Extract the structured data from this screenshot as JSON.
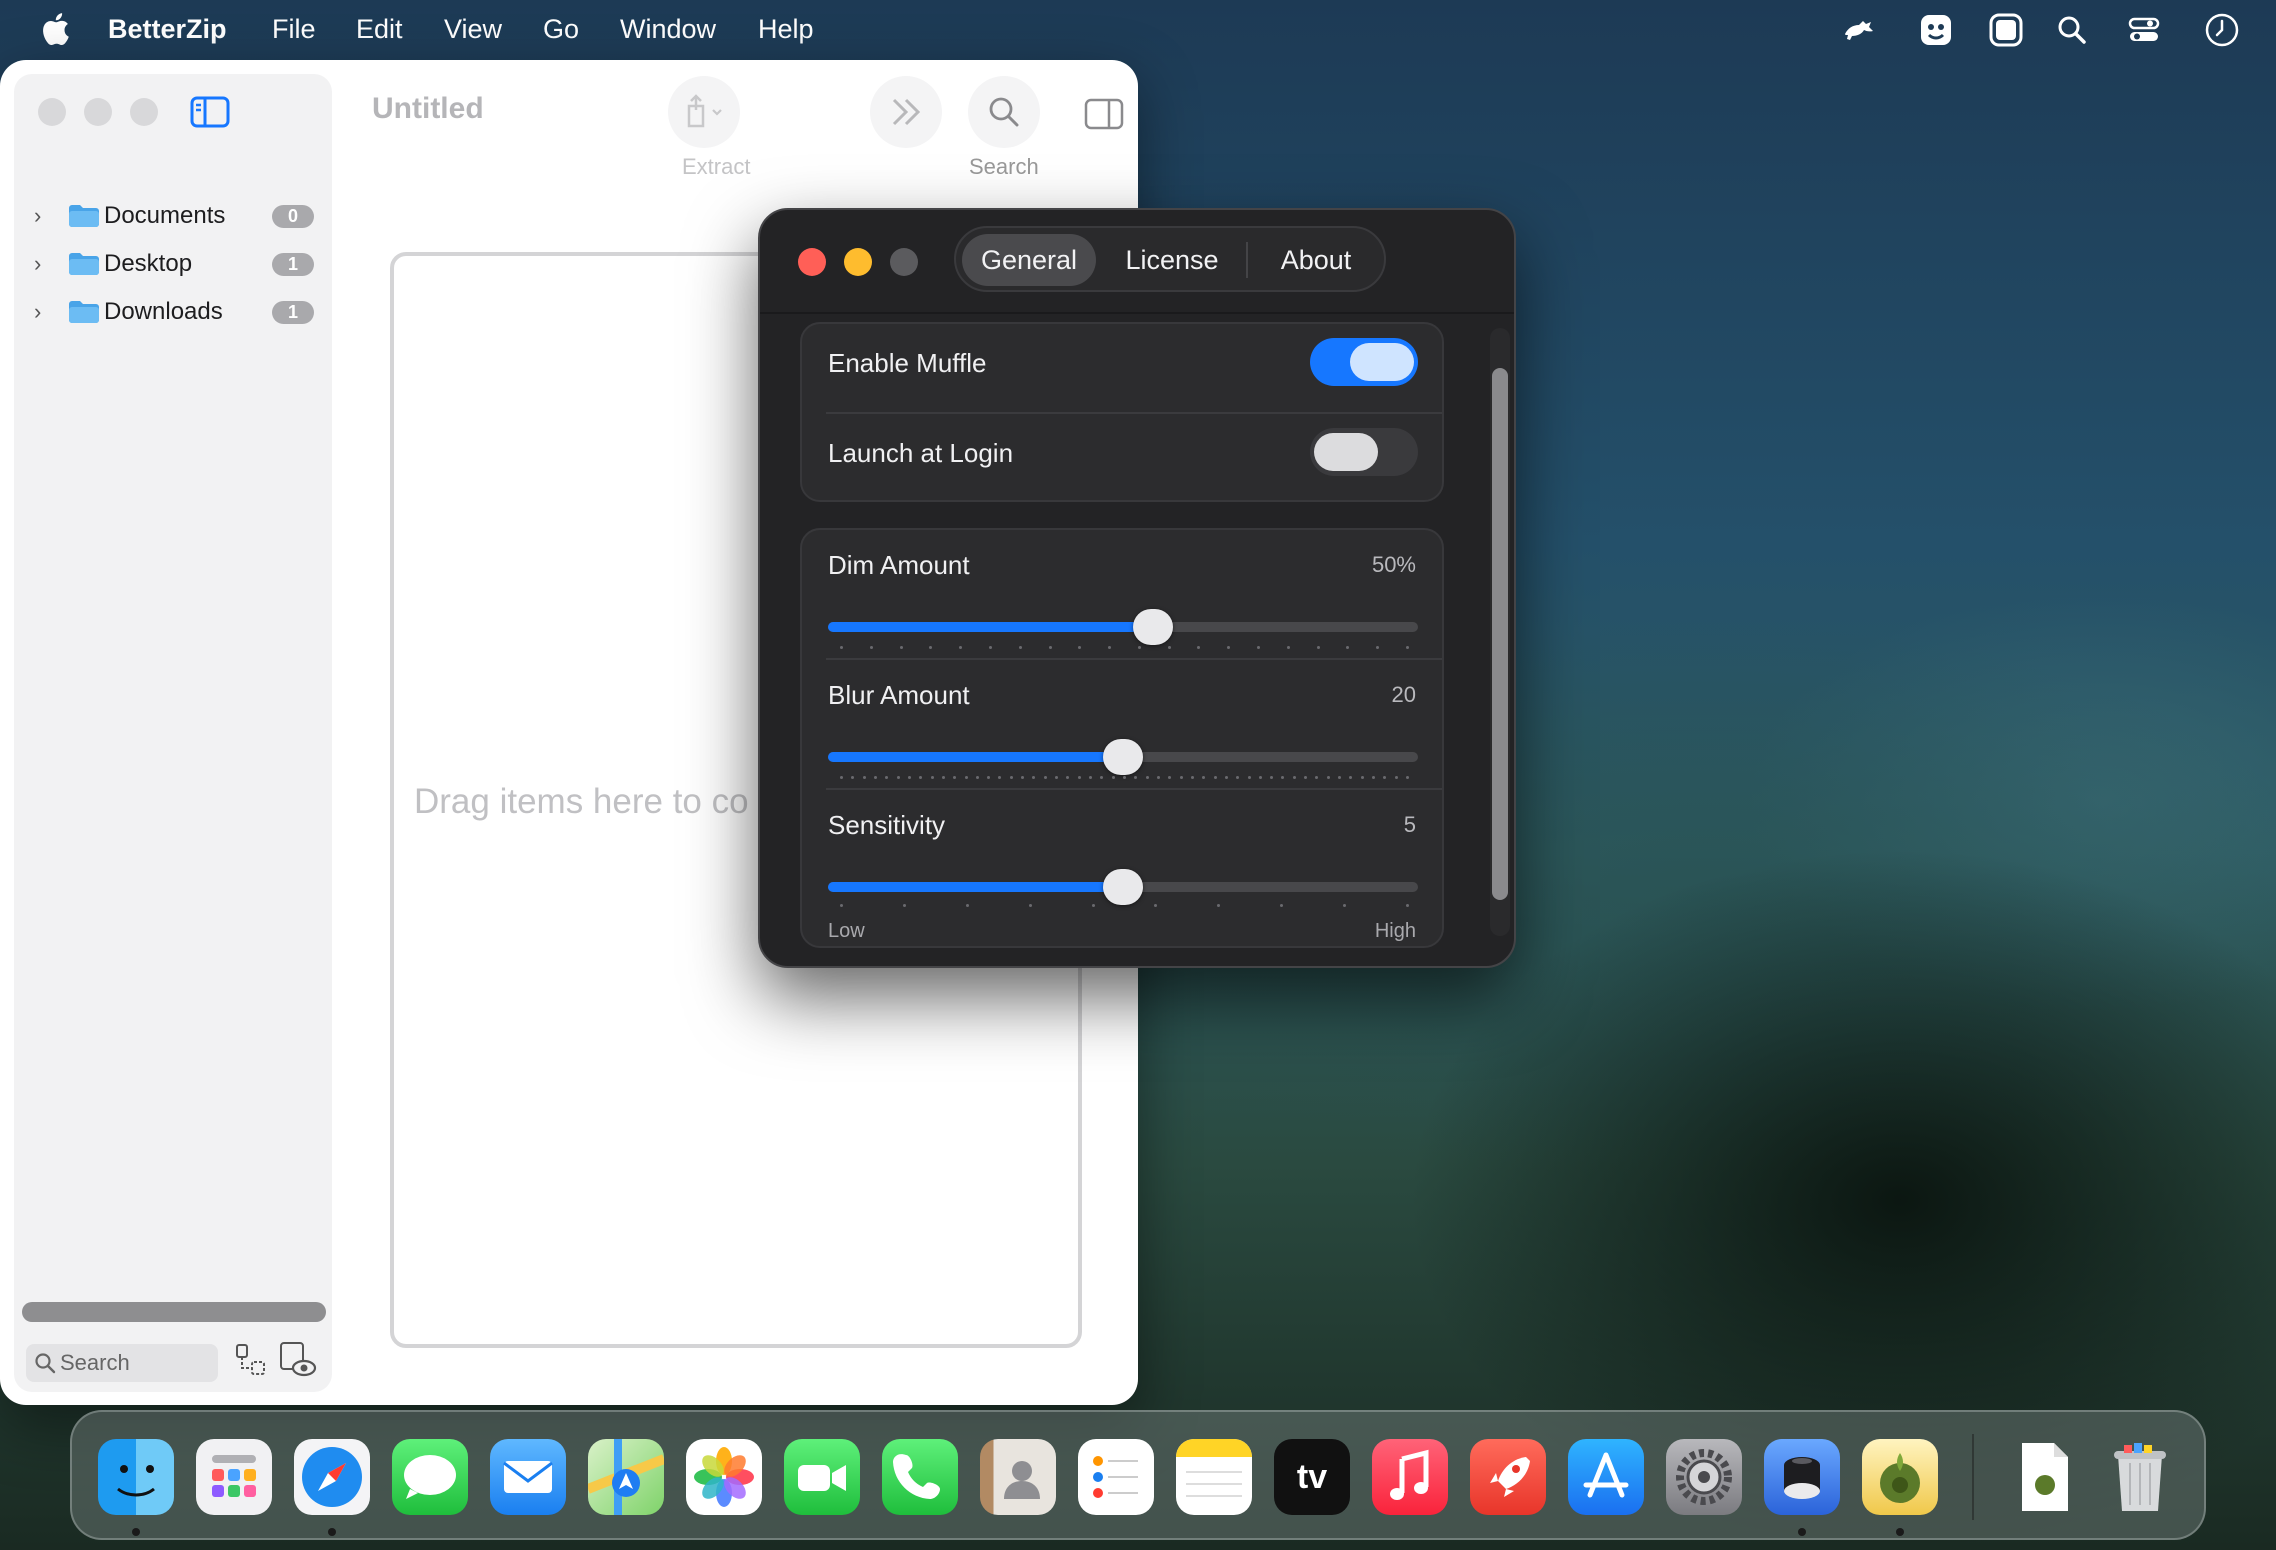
{
  "menubar": {
    "app_name": "BetterZip",
    "items": [
      "File",
      "Edit",
      "View",
      "Go",
      "Window",
      "Help"
    ],
    "status_icons": [
      "bartender-icon",
      "face-icon",
      "screen-icon",
      "spotlight-search-icon",
      "control-center-icon",
      "clock-icon"
    ]
  },
  "betterzip": {
    "title": "Untitled",
    "toolbar": {
      "extract_label": "Extract",
      "search_label": "Search"
    },
    "sidebar": {
      "items": [
        {
          "label": "Documents",
          "count": "0"
        },
        {
          "label": "Desktop",
          "count": "1"
        },
        {
          "label": "Downloads",
          "count": "1"
        }
      ],
      "search_placeholder": "Search"
    },
    "drop_text": "Drag items here to co"
  },
  "muffle": {
    "tabs": [
      "General",
      "License",
      "About"
    ],
    "active_tab": "General",
    "enable_muffle": {
      "label": "Enable Muffle",
      "on": true
    },
    "launch_at_login": {
      "label": "Launch at Login",
      "on": false
    },
    "dim_amount": {
      "label": "Dim Amount",
      "value_text": "50%",
      "fraction": 0.55
    },
    "blur_amount": {
      "label": "Blur Amount",
      "value_text": "20",
      "fraction": 0.5
    },
    "sensitivity": {
      "label": "Sensitivity",
      "value_text": "5",
      "fraction": 0.5,
      "low_label": "Low",
      "high_label": "High"
    }
  },
  "dock": {
    "apps": [
      "finder-icon",
      "launchpad-icon",
      "safari-icon",
      "messages-icon",
      "mail-icon",
      "maps-icon",
      "photos-icon",
      "facetime-icon",
      "phone-icon",
      "contacts-icon",
      "reminders-icon",
      "notes-icon",
      "apple-tv-icon",
      "music-icon",
      "rocket-typist-icon",
      "app-store-icon",
      "system-settings-icon",
      "muffle-app-icon",
      "betterzip-icon"
    ],
    "tv_text": "tv",
    "colors": {
      "accent": "#1677ff",
      "close": "#ff5f57",
      "minimize": "#febc2e"
    }
  }
}
